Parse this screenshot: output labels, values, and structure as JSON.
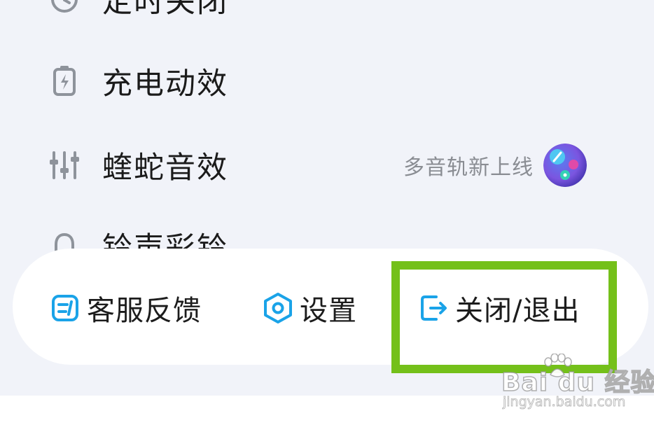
{
  "menu": {
    "items": [
      {
        "label": "定时关闭",
        "icon": "clock-icon"
      },
      {
        "label": "充电动效",
        "icon": "battery-charging-icon"
      },
      {
        "label": "蝰蛇音效",
        "icon": "equalizer-icon",
        "extra": "多音轨新上线"
      },
      {
        "label": "铃声彩铃",
        "icon": "bell-icon"
      }
    ]
  },
  "bottom_bar": {
    "feedback_label": "客服反馈",
    "settings_label": "设置",
    "exit_label": "关闭/退出"
  },
  "watermark": {
    "brand": "Bai du 经验",
    "url": "jingyan.baidu.com"
  },
  "colors": {
    "accent_blue": "#1aa3e8",
    "icon_gray": "#8e939b",
    "highlight_green": "#74c01a",
    "background": "#f1f3f9"
  }
}
